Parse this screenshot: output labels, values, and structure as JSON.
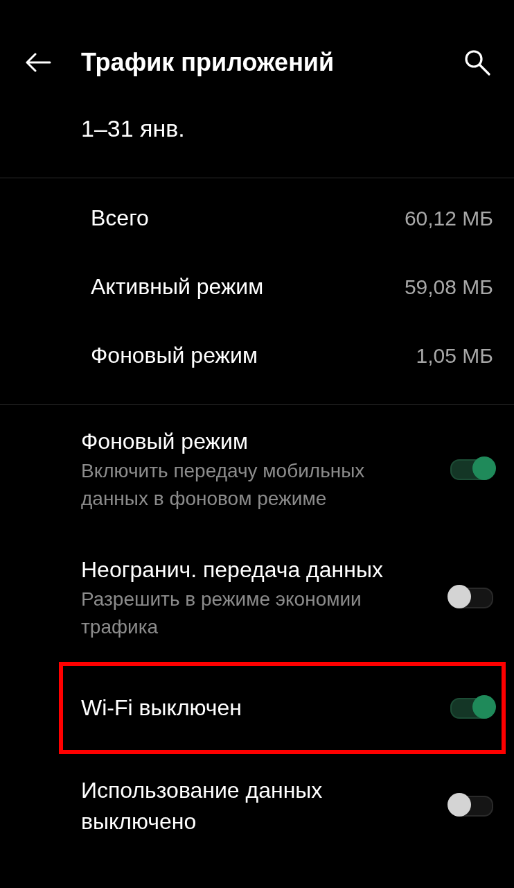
{
  "header": {
    "title": "Трафик приложений"
  },
  "period": "1–31 янв.",
  "usage": [
    {
      "label": "Всего",
      "value": "60,12 МБ"
    },
    {
      "label": "Активный режим",
      "value": "59,08 МБ"
    },
    {
      "label": "Фоновый режим",
      "value": "1,05 МБ"
    }
  ],
  "settings": [
    {
      "title": "Фоновый режим",
      "subtitle": "Включить передачу мобильных данных в фоновом режиме",
      "on": true,
      "highlighted": false
    },
    {
      "title": "Неогранич. передача данных",
      "subtitle": "Разрешить в режиме экономии трафика",
      "on": false,
      "highlighted": false
    },
    {
      "title": "Wi-Fi выключен",
      "on": true,
      "highlighted": true
    },
    {
      "title": "Использование данных выключено",
      "on": false,
      "highlighted": false
    }
  ]
}
